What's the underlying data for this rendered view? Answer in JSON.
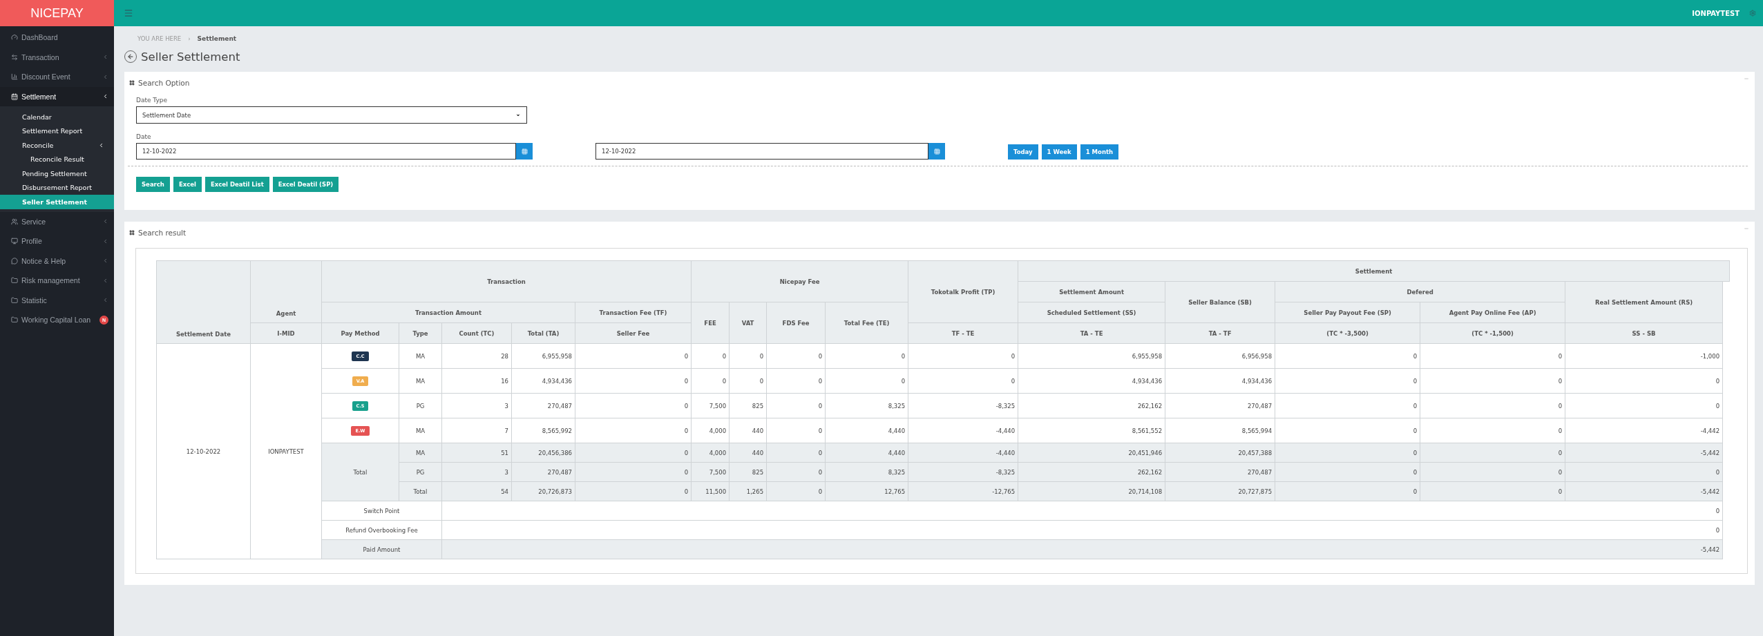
{
  "brand": "NICEPAY",
  "header": {
    "user": "IONPAYTEST"
  },
  "sidebar": {
    "items": [
      {
        "label": "DashBoard",
        "expandable": false,
        "expanded": false,
        "selected": false
      },
      {
        "label": "Transaction",
        "expandable": true,
        "expanded": false,
        "selected": false
      },
      {
        "label": "Discount Event",
        "expandable": true,
        "expanded": false,
        "selected": false
      },
      {
        "label": "Settlement",
        "expandable": true,
        "expanded": true,
        "selected": false,
        "children": [
          {
            "label": "Calendar",
            "selected": false,
            "expandable": false,
            "expanded": false
          },
          {
            "label": "Settlement Report",
            "selected": false,
            "expandable": false,
            "expanded": false
          },
          {
            "label": "Reconcile",
            "selected": false,
            "expandable": true,
            "expanded": true,
            "children": [
              {
                "label": "Reconcile Result",
                "selected": false,
                "expandable": false,
                "expanded": false
              }
            ]
          },
          {
            "label": "Pending Settlement",
            "selected": false,
            "expandable": false,
            "expanded": false
          },
          {
            "label": "Disbursement Report",
            "selected": false,
            "expandable": false,
            "expanded": false
          },
          {
            "label": "Seller Settlement",
            "selected": true,
            "expandable": false,
            "expanded": false
          }
        ]
      },
      {
        "label": "Service",
        "expandable": true,
        "expanded": false,
        "selected": false
      },
      {
        "label": "Profile",
        "expandable": true,
        "expanded": false,
        "selected": false
      },
      {
        "label": "Notice & Help",
        "expandable": true,
        "expanded": false,
        "selected": false
      },
      {
        "label": "Risk management",
        "expandable": true,
        "expanded": false,
        "selected": false
      },
      {
        "label": "Statistic",
        "expandable": true,
        "expanded": false,
        "selected": false
      },
      {
        "label": "Working Capital Loan",
        "expandable": false,
        "expanded": false,
        "selected": false,
        "badge": "N"
      }
    ]
  },
  "breadcrumb": {
    "prefix": "YOU ARE HERE",
    "separator": "›",
    "current": "Settlement"
  },
  "page_title": "Seller Settlement",
  "search_option": {
    "title": "Search Option",
    "date_type": {
      "label": "Date Type",
      "value": "Settlement Date"
    },
    "date": {
      "label": "Date",
      "from": "12-10-2022",
      "to": "12-10-2022"
    },
    "quick_ranges": [
      "Today",
      "1 Week",
      "1 Month"
    ],
    "actions": [
      "Search",
      "Excel",
      "Excel Deatil List",
      "Excel Deatil (SP)"
    ]
  },
  "search_result": {
    "title": "Search result",
    "header": {
      "settlement_date": "Settlement Date",
      "agent": "Agent",
      "i_mid": "I-MID",
      "transaction": "Transaction",
      "nicepay_fee": "Nicepay Fee",
      "tokotalk_profit": "Tokotalk Profit (TP)",
      "settlement": "Settlement",
      "settlement_amount": "Settlement Amount",
      "seller_balance": "Seller Balance (SB)",
      "defered": "Defered",
      "real_settlement": "Real Settlement Amount (RS)",
      "transaction_amount": "Transaction Amount",
      "transaction_fee": "Transaction Fee (TF)",
      "scheduled_settlement": "Scheduled Settlement (SS)",
      "seller_pay": "Seller Pay Payout Fee (SP)",
      "agent_pay": "Agent Pay Online Fee (AP)",
      "columns": [
        "Pay Method",
        "Type",
        "Count (TC)",
        "Total (TA)",
        "Seller Fee",
        "FEE",
        "VAT",
        "FDS Fee",
        "Total Fee (TE)",
        "TF - TE",
        "TA - TE",
        "TA - TF",
        "(TC * -3,500)",
        "(TC * -1,500)",
        "SS - SB"
      ]
    },
    "date": "12-10-2022",
    "agent": "IONPAYTEST",
    "methods": [
      {
        "badge": "C.C",
        "color": "#1e3550",
        "type": "MA",
        "values": [
          "28",
          "6,955,958",
          "0",
          "0",
          "0",
          "0",
          "0",
          "0",
          "6,955,958",
          "6,956,958",
          "0",
          "0",
          "-1,000"
        ]
      },
      {
        "badge": "V.A",
        "color": "#f0ad4e",
        "type": "MA",
        "values": [
          "16",
          "4,934,436",
          "0",
          "0",
          "0",
          "0",
          "0",
          "0",
          "4,934,436",
          "4,934,436",
          "0",
          "0",
          "0"
        ]
      },
      {
        "badge": "C.S",
        "color": "#17a08c",
        "type": "PG",
        "values": [
          "3",
          "270,487",
          "0",
          "7,500",
          "825",
          "0",
          "8,325",
          "-8,325",
          "262,162",
          "270,487",
          "0",
          "0",
          "0"
        ]
      },
      {
        "badge": "E.W",
        "color": "#e55353",
        "type": "MA",
        "values": [
          "7",
          "8,565,992",
          "0",
          "4,000",
          "440",
          "0",
          "4,440",
          "-4,440",
          "8,561,552",
          "8,565,994",
          "0",
          "0",
          "-4,442"
        ]
      }
    ],
    "total_label": "Total",
    "totals": [
      {
        "type": "MA",
        "values": [
          "51",
          "20,456,386",
          "0",
          "4,000",
          "440",
          "0",
          "4,440",
          "-4,440",
          "20,451,946",
          "20,457,388",
          "0",
          "0",
          "-5,442"
        ]
      },
      {
        "type": "PG",
        "values": [
          "3",
          "270,487",
          "0",
          "7,500",
          "825",
          "0",
          "8,325",
          "-8,325",
          "262,162",
          "270,487",
          "0",
          "0",
          "0"
        ]
      },
      {
        "type": "Total",
        "values": [
          "54",
          "20,726,873",
          "0",
          "11,500",
          "1,265",
          "0",
          "12,765",
          "-12,765",
          "20,714,108",
          "20,727,875",
          "0",
          "0",
          "-5,442"
        ]
      }
    ],
    "summary": [
      {
        "label": "Switch Point",
        "value": "0",
        "shaded": false
      },
      {
        "label": "Refund Overbooking Fee",
        "value": "0",
        "shaded": false
      },
      {
        "label": "Paid Amount",
        "value": "-5,442",
        "shaded": true
      }
    ]
  }
}
